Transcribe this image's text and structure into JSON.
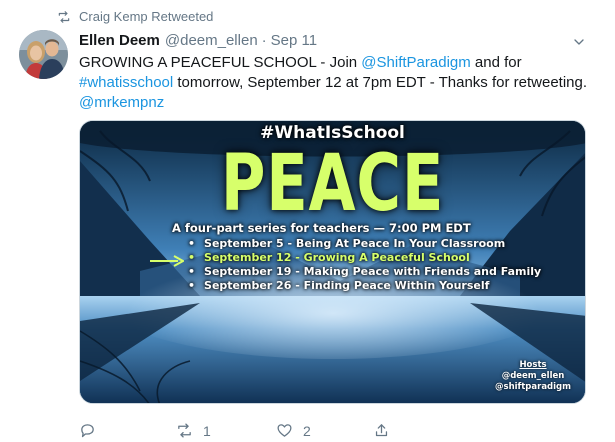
{
  "retweet": {
    "label": "Craig Kemp Retweeted",
    "icon": "retweet-icon"
  },
  "tweet": {
    "author_name": "Ellen Deem",
    "handle": "@deem_ellen",
    "separator": "·",
    "date": "Sep 11",
    "text": {
      "part1": "GROWING A PEACEFUL SCHOOL - Join ",
      "mention1": "@ShiftParadigm",
      "part2": " and for ",
      "hashtag": "#whatisschool",
      "part3": " tomorrow, September 12 at 7pm EDT - Thanks for retweeting. ",
      "mention2": "@mrkempnz"
    }
  },
  "media": {
    "hashtag": "#WhatIsSchool",
    "title": "PEACE",
    "intro": "A four-part series for teachers — 7:00 PM EDT",
    "sessions": [
      {
        "bullet": "•",
        "text": "September  5 - Being At Peace In Your Classroom"
      },
      {
        "bullet": "•",
        "text": "September 12 - Growing A Peaceful School"
      },
      {
        "bullet": "•",
        "text": "September 19 - Making Peace with Friends and Family"
      },
      {
        "bullet": "•",
        "text": "September 26 - Finding Peace Within Yourself"
      }
    ],
    "hosts_title": "Hosts",
    "hosts": [
      "@deem_ellen",
      "@shiftparadigm"
    ]
  },
  "actions": {
    "reply_count": "",
    "retweet_count": "1",
    "like_count": "2"
  },
  "colors": {
    "link": "#1b95e0",
    "muted": "#657786",
    "peace_green": "#d7ff6b"
  }
}
